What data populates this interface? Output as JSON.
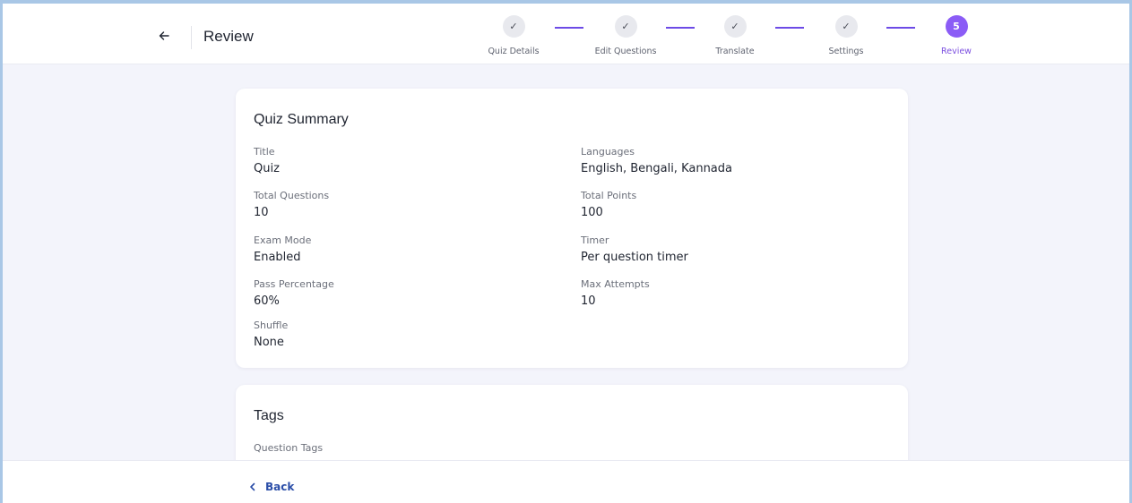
{
  "header": {
    "title": "Review"
  },
  "stepper": {
    "steps": [
      {
        "label": "Quiz Details",
        "symbol": "✓",
        "state": "done"
      },
      {
        "label": "Edit Questions",
        "symbol": "✓",
        "state": "done"
      },
      {
        "label": "Translate",
        "symbol": "✓",
        "state": "done"
      },
      {
        "label": "Settings",
        "symbol": "✓",
        "state": "done"
      },
      {
        "label": "Review",
        "symbol": "5",
        "state": "active"
      }
    ]
  },
  "summary": {
    "title": "Quiz Summary",
    "fields": {
      "title": {
        "label": "Title",
        "value": "Quiz"
      },
      "languages": {
        "label": "Languages",
        "value": "English, Bengali, Kannada"
      },
      "total_questions": {
        "label": "Total Questions",
        "value": "10"
      },
      "total_points": {
        "label": "Total Points",
        "value": "100"
      },
      "exam_mode": {
        "label": "Exam Mode",
        "value": "Enabled"
      },
      "timer": {
        "label": "Timer",
        "value": "Per question timer"
      },
      "pass_percentage": {
        "label": "Pass Percentage",
        "value": "60%"
      },
      "max_attempts": {
        "label": "Max Attempts",
        "value": "10"
      },
      "shuffle": {
        "label": "Shuffle",
        "value": "None"
      }
    }
  },
  "tags": {
    "title": "Tags",
    "question_tags_label": "Question Tags"
  },
  "footer": {
    "back_label": "Back"
  },
  "colors": {
    "accent": "#8b5cf6",
    "stepper_line": "#6d4be6",
    "back_link": "#2b4ea8",
    "background": "#f3f4fb"
  }
}
